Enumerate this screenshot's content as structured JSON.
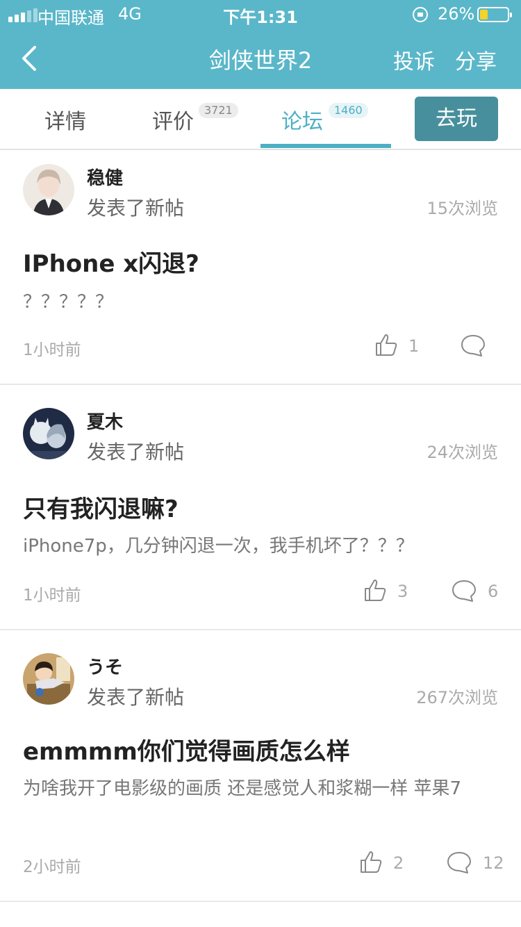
{
  "status_bar": {
    "carrier": "中国联通",
    "network": "4G",
    "time": "下午1:31",
    "battery": "26%"
  },
  "nav": {
    "title": "剑侠世界2",
    "complain": "投诉",
    "share": "分享"
  },
  "tabs": [
    {
      "label": "详情"
    },
    {
      "label": "评价",
      "badge": "3721"
    },
    {
      "label": "论坛",
      "badge": "1460",
      "active": true
    }
  ],
  "play_button": "去玩",
  "accent_color": "#4db0c4",
  "header_color": "#5ab7c9",
  "posts": [
    {
      "author": "稳健",
      "action": "发表了新帖",
      "views": "15次浏览",
      "title": "IPhone x闪退?",
      "body": "？？？？？",
      "time": "1小时前",
      "likes": "1",
      "comments": ""
    },
    {
      "author": "夏木",
      "action": "发表了新帖",
      "views": "24次浏览",
      "title": "只有我闪退嘛?",
      "body": "iPhone7p，几分钟闪退一次，我手机坏了？？？",
      "time": "1小时前",
      "likes": "3",
      "comments": "6"
    },
    {
      "author": "うそ",
      "action": "发表了新帖",
      "views": "267次浏览",
      "title": "emmmm你们觉得画质怎么样",
      "body": "为啥我开了电影级的画质 还是感觉人和浆糊一样 苹果7",
      "time": "2小时前",
      "likes": "2",
      "comments": "12"
    }
  ]
}
